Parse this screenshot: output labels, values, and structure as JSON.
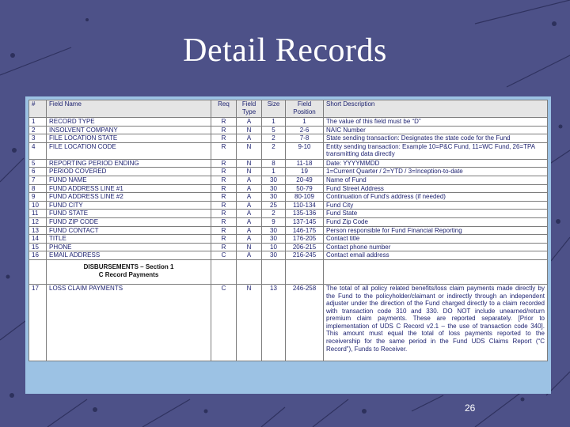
{
  "slide": {
    "title": "Detail Records",
    "page_number": "26"
  },
  "table": {
    "headers": {
      "num": "#",
      "field_name": "Field Name",
      "req": "Req",
      "field_type": "Field Type",
      "size": "Size",
      "field_position": "Field Position",
      "short_description": "Short Description"
    },
    "rows": [
      {
        "num": "1",
        "name": "RECORD TYPE",
        "req": "R",
        "type": "A",
        "size": "1",
        "pos": "1",
        "desc": "The value of this field must be “D”"
      },
      {
        "num": "2",
        "name": "INSOLVENT COMPANY",
        "req": "R",
        "type": "N",
        "size": "5",
        "pos": "2-6",
        "desc": "NAIC Number"
      },
      {
        "num": "3",
        "name": "FILE LOCATION STATE",
        "req": "R",
        "type": "A",
        "size": "2",
        "pos": "7-8",
        "desc": "State sending transaction: Designates the state code for the Fund"
      },
      {
        "num": "4",
        "name": "FILE LOCATION CODE",
        "req": "R",
        "type": "N",
        "size": "2",
        "pos": "9-10",
        "desc": "Entity sending transaction: Example 10=P&C Fund, 11=WC Fund, 26=TPA transmitting data directly"
      },
      {
        "num": "5",
        "name": "REPORTING PERIOD ENDING",
        "req": "R",
        "type": "N",
        "size": "8",
        "pos": "11-18",
        "desc": "Date: YYYYMMDD"
      },
      {
        "num": "6",
        "name": "PERIOD COVERED",
        "req": "R",
        "type": "N",
        "size": "1",
        "pos": "19",
        "desc": "1=Current Quarter / 2=YTD / 3=Inception-to-date"
      },
      {
        "num": "7",
        "name": "FUND NAME",
        "req": "R",
        "type": "A",
        "size": "30",
        "pos": "20-49",
        "desc": "Name of Fund"
      },
      {
        "num": "8",
        "name": "FUND ADDRESS LINE #1",
        "req": "R",
        "type": "A",
        "size": "30",
        "pos": "50-79",
        "desc": "Fund Street Address"
      },
      {
        "num": "9",
        "name": "FUND ADDRESS LINE #2",
        "req": "R",
        "type": "A",
        "size": "30",
        "pos": "80-109",
        "desc": "Continuation of Fund's address (if needed)"
      },
      {
        "num": "10",
        "name": "FUND CITY",
        "req": "R",
        "type": "A",
        "size": "25",
        "pos": "110-134",
        "desc": "Fund City"
      },
      {
        "num": "11",
        "name": "FUND STATE",
        "req": "R",
        "type": "A",
        "size": "2",
        "pos": "135-136",
        "desc": "Fund State"
      },
      {
        "num": "12",
        "name": "FUND ZIP CODE",
        "req": "R",
        "type": "A",
        "size": "9",
        "pos": "137-145",
        "desc": "Fund Zip Code"
      },
      {
        "num": "13",
        "name": "FUND CONTACT",
        "req": "R",
        "type": "A",
        "size": "30",
        "pos": "146-175",
        "desc": "Person responsible for Fund Financial Reporting"
      },
      {
        "num": "14",
        "name": "TITLE",
        "req": "R",
        "type": "A",
        "size": "30",
        "pos": "176-205",
        "desc": "Contact title"
      },
      {
        "num": "15",
        "name": "PHONE",
        "req": "R",
        "type": "N",
        "size": "10",
        "pos": "206-215",
        "desc": "Contact phone number"
      },
      {
        "num": "16",
        "name": "EMAIL ADDRESS",
        "req": "C",
        "type": "A",
        "size": "30",
        "pos": "216-245",
        "desc": "Contact email address"
      }
    ],
    "section": {
      "line1": "DISBURSEMENTS – Section 1",
      "line2": "C Record Payments"
    },
    "last_row": {
      "num": "17",
      "name": "LOSS CLAIM PAYMENTS",
      "req": "C",
      "type": "N",
      "size": "13",
      "pos": "246-258",
      "desc": "The total of all policy related benefits/loss claim payments made directly by the Fund to the policyholder/claimant or indirectly through an independent adjuster under the direction of the Fund charged directly to a claim recorded with transaction code 310 and 330. DO NOT include unearned/return premium claim payments. These are reported separately. [Prior to implementation of UDS C Record v2.1 – the use of transaction code 340]. This amount must equal the total of loss payments reported to the receivership for the same period in the Fund UDS Claims Report (“C Record”), Funds to Receiver."
    }
  }
}
